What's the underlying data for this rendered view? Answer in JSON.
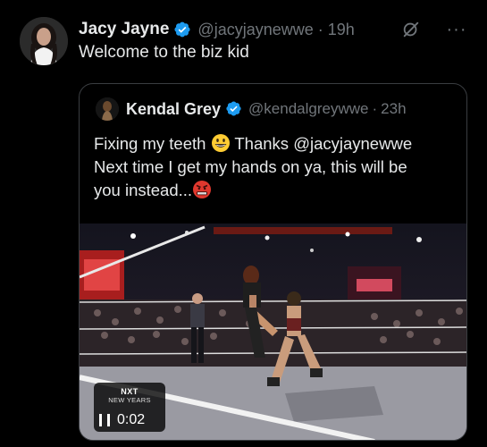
{
  "tweet": {
    "author_name": "Jacy Jayne",
    "handle": "@jacyjaynewwe",
    "separator": "·",
    "time": "19h",
    "text": "Welcome to the biz kid",
    "more_label": "···"
  },
  "quoted": {
    "author_name": "Kendal Grey",
    "handle": "@kendalgreywwe",
    "separator": "·",
    "time": "23h",
    "line1_a": "Fixing my teeth ",
    "line1_b": " Thanks @jacyjaynewwe",
    "line2": "Next time I get my hands on ya, this will be",
    "line3": "you instead...",
    "media": {
      "brand": "NXT",
      "event": "NEW YEARS",
      "duration": "0:02",
      "state": "playing"
    }
  },
  "colors": {
    "background": "#000000",
    "text": "#e7e9ea",
    "muted": "#71767b",
    "verified": "#1d9bf0",
    "border": "#3a3d41"
  },
  "icons": [
    "verified-badge-icon",
    "grok-icon",
    "more-icon",
    "grinning-emoji-icon",
    "angry-emoji-icon",
    "pause-icon"
  ]
}
